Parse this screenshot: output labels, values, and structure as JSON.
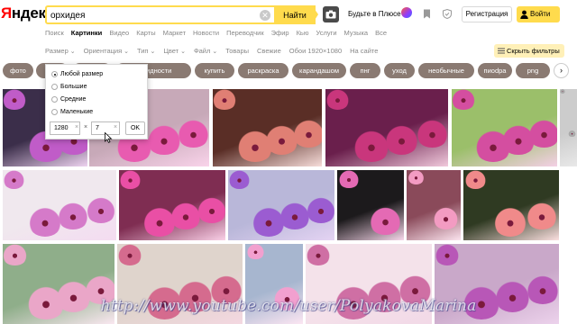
{
  "header": {
    "logo_ya": "Я",
    "logo_rest": "ндекс",
    "search": {
      "value": "орхидея"
    },
    "find_label": "Найти",
    "plus_label": "Будьте в Плюсе",
    "register_label": "Регистрация",
    "login_label": "Войти"
  },
  "services": [
    "Поиск",
    "Картинки",
    "Видео",
    "Карты",
    "Маркет",
    "Новости",
    "Переводчик",
    "Эфир",
    "Кью",
    "Услуги",
    "Музыка",
    "Все"
  ],
  "active_service": "Картинки",
  "filters": {
    "items": [
      {
        "label": "Размер",
        "dropdown": true
      },
      {
        "label": "Ориентация",
        "dropdown": true
      },
      {
        "label": "Тип",
        "dropdown": true
      },
      {
        "label": "Цвет",
        "dropdown": true
      },
      {
        "label": "Файл",
        "dropdown": true
      },
      {
        "label": "Товары",
        "dropdown": false
      },
      {
        "label": "Свежие",
        "dropdown": false
      },
      {
        "label": "Обои 1920×1080",
        "dropdown": false
      },
      {
        "label": "На сайте",
        "dropdown": false
      }
    ],
    "hide_label": "Скрыть фильтры"
  },
  "tags": [
    "фото",
    "",
    "",
    "",
    "",
    "",
    "",
    "",
    "",
    "",
    "",
    ""
  ],
  "tag_labels": [
    "фото",
    "о",
    "",
    "новидности",
    "купить",
    "раскраска",
    "карандашом",
    "пнг",
    "уход",
    "необычные",
    "пиоdра",
    "png",
    "пр"
  ],
  "size_popup": {
    "options": [
      "Любой размер",
      "Большие",
      "Средние",
      "Маленькие"
    ],
    "selected": "Любой размер",
    "width_value": "1280",
    "height_value": "7",
    "times": "×",
    "ok_label": "OK"
  },
  "watermark": "http://www.youtube.com/user/PolyakovaMarina",
  "colors": {
    "accent_yellow": "#ffdb4d",
    "logo_red": "#ff0000",
    "chip_bg": "#8a7a72"
  },
  "icons": [
    "clear-icon",
    "camera-icon",
    "plus-icon",
    "bookmark-icon",
    "shield-icon",
    "user-icon",
    "filter-icon",
    "chevron-right-icon",
    "cursor-icon"
  ]
}
